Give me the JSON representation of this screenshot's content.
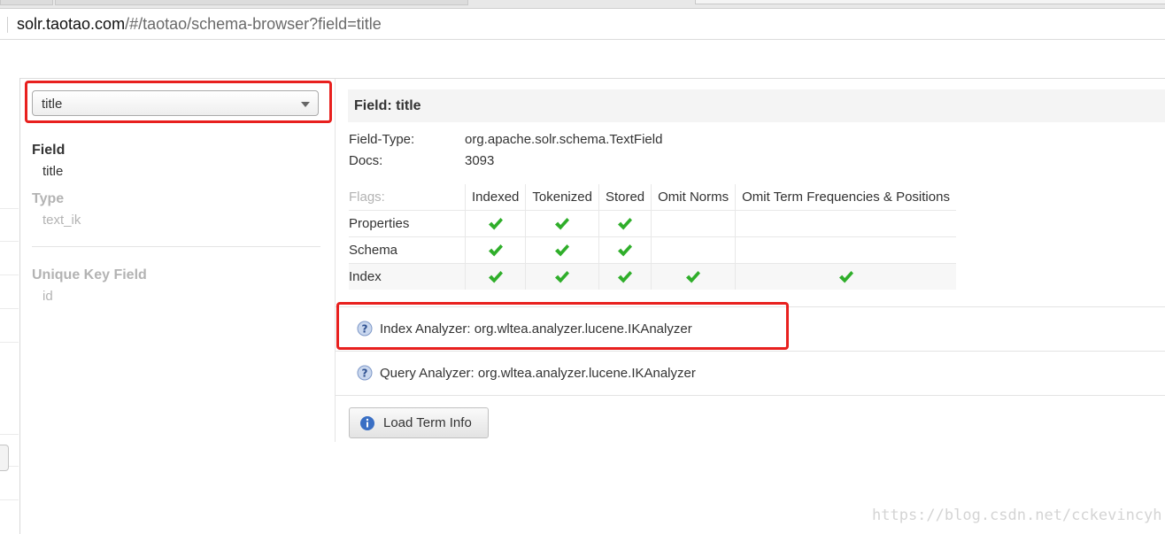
{
  "browser": {
    "url_host": "solr.taotao.com",
    "url_path": "/#/taotao/schema-browser?field=title"
  },
  "sidebar": {
    "field_select": {
      "value": "title"
    },
    "field_label": "Field",
    "field_value": "title",
    "type_label": "Type",
    "type_value": "text_ik",
    "unique_key_label": "Unique Key Field",
    "unique_key_value": "id"
  },
  "main": {
    "header": "Field: title",
    "field_type_label": "Field-Type:",
    "field_type_value": "org.apache.solr.schema.TextField",
    "docs_label": "Docs:",
    "docs_value": "3093",
    "flags": {
      "label": "Flags:",
      "columns": [
        "Indexed",
        "Tokenized",
        "Stored",
        "Omit Norms",
        "Omit Term Frequencies & Positions"
      ],
      "rows": [
        {
          "label": "Properties",
          "checks": [
            true,
            true,
            true,
            false,
            false
          ]
        },
        {
          "label": "Schema",
          "checks": [
            true,
            true,
            true,
            false,
            false
          ]
        },
        {
          "label": "Index",
          "checks": [
            true,
            true,
            true,
            true,
            true
          ]
        }
      ]
    },
    "index_analyzer": "Index Analyzer: org.wltea.analyzer.lucene.IKAnalyzer",
    "query_analyzer": "Query Analyzer: org.wltea.analyzer.lucene.IKAnalyzer",
    "load_term_info_label": "Load Term Info"
  },
  "watermark": "https://blog.csdn.net/cckevincyh",
  "colors": {
    "highlight_border": "#e8201e",
    "check_green": "#2fae2a",
    "info_blue": "#3a6fc4"
  },
  "icons": {
    "check": "check-icon",
    "help": "help-icon",
    "info": "info-icon",
    "dropdown": "chevron-down-icon"
  }
}
